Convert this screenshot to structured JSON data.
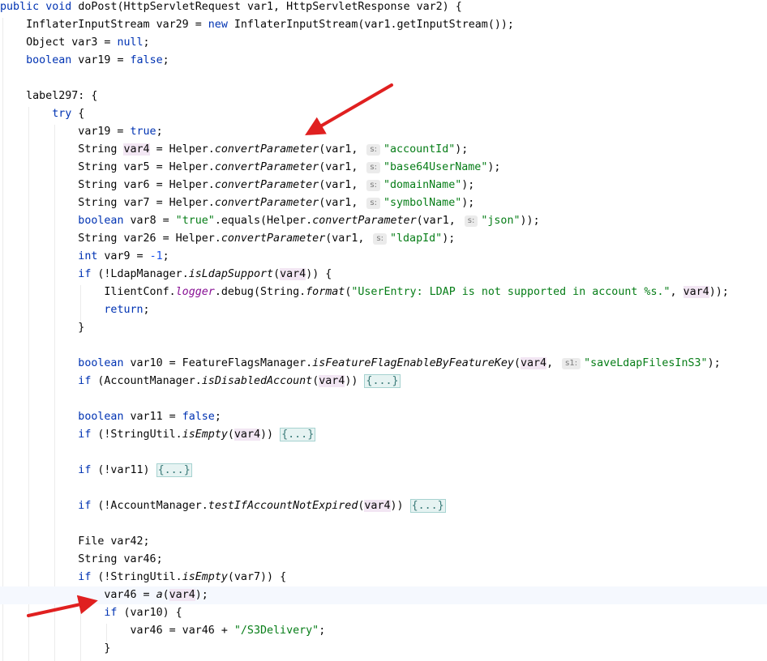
{
  "code": {
    "accent_keyword": "#0033b3",
    "accent_string": "#067d17",
    "lines": [
      {
        "id": "l1",
        "parts": [
          [
            "kw",
            "public"
          ],
          [
            "",
            " "
          ],
          [
            "kw",
            "void"
          ],
          [
            "",
            " doPost(HttpServletRequest var1, HttpServletResponse var2) {"
          ]
        ]
      },
      {
        "id": "l2",
        "parts": [
          [
            "",
            "    InflaterInputStream var29 = "
          ],
          [
            "kw",
            "new"
          ],
          [
            "",
            ""
          ],
          [
            "",
            " InflaterInputStream(var1.getInputStream());"
          ]
        ]
      },
      {
        "id": "l3",
        "parts": [
          [
            "",
            "    Object var3 = "
          ],
          [
            "kw",
            "null"
          ],
          [
            "",
            ";"
          ]
        ]
      },
      {
        "id": "l4",
        "parts": [
          [
            "",
            "    "
          ],
          [
            "kw",
            "boolean"
          ],
          [
            "",
            " var19 = "
          ],
          [
            "kw",
            "false"
          ],
          [
            "",
            ";"
          ]
        ]
      },
      {
        "id": "l5",
        "parts": []
      },
      {
        "id": "l6",
        "parts": [
          [
            "",
            "    label297: {"
          ]
        ]
      },
      {
        "id": "l7",
        "parts": [
          [
            "",
            "        "
          ],
          [
            "kw",
            "try"
          ],
          [
            "",
            " {"
          ]
        ]
      },
      {
        "id": "l8",
        "parts": [
          [
            "",
            "            var19 = "
          ],
          [
            "kw",
            "true"
          ],
          [
            "",
            ";"
          ]
        ]
      },
      {
        "id": "l9",
        "parts": [
          [
            "",
            "            String "
          ],
          [
            "var4",
            "var4"
          ],
          [
            "",
            " = Helper."
          ],
          [
            "st",
            "convertParameter"
          ],
          [
            "",
            "(var1, "
          ],
          [
            "hint",
            "s:"
          ],
          [
            "str",
            "\"accountId\""
          ],
          [
            "",
            ");"
          ]
        ]
      },
      {
        "id": "l10",
        "parts": [
          [
            "",
            "            String var5 = Helper."
          ],
          [
            "st",
            "convertParameter"
          ],
          [
            "",
            "(var1, "
          ],
          [
            "hint",
            "s:"
          ],
          [
            "str",
            "\"base64UserName\""
          ],
          [
            "",
            ");"
          ]
        ]
      },
      {
        "id": "l11",
        "parts": [
          [
            "",
            "            String var6 = Helper."
          ],
          [
            "st",
            "convertParameter"
          ],
          [
            "",
            "(var1, "
          ],
          [
            "hint",
            "s:"
          ],
          [
            "str",
            "\"domainName\""
          ],
          [
            "",
            ");"
          ]
        ]
      },
      {
        "id": "l12",
        "parts": [
          [
            "",
            "            String var7 = Helper."
          ],
          [
            "st",
            "convertParameter"
          ],
          [
            "",
            "(var1, "
          ],
          [
            "hint",
            "s:"
          ],
          [
            "str",
            "\"symbolName\""
          ],
          [
            "",
            ");"
          ]
        ]
      },
      {
        "id": "l13",
        "parts": [
          [
            "",
            "            "
          ],
          [
            "kw",
            "boolean"
          ],
          [
            "",
            " var8 = "
          ],
          [
            "str",
            "\"true\""
          ],
          [
            "",
            ".equals(Helper."
          ],
          [
            "st",
            "convertParameter"
          ],
          [
            "",
            "(var1, "
          ],
          [
            "hint",
            "s:"
          ],
          [
            "str",
            "\"json\""
          ],
          [
            "",
            "));"
          ]
        ]
      },
      {
        "id": "l14",
        "parts": [
          [
            "",
            "            String var26 = Helper."
          ],
          [
            "st",
            "convertParameter"
          ],
          [
            "",
            "(var1, "
          ],
          [
            "hint",
            "s:"
          ],
          [
            "str",
            "\"ldapId\""
          ],
          [
            "",
            ");"
          ]
        ]
      },
      {
        "id": "l15",
        "parts": [
          [
            "",
            "            "
          ],
          [
            "kw",
            "int"
          ],
          [
            "",
            " var9 = "
          ],
          [
            "num",
            "-1"
          ],
          [
            "",
            ";"
          ]
        ]
      },
      {
        "id": "l16",
        "parts": [
          [
            "",
            "            "
          ],
          [
            "kw",
            "if"
          ],
          [
            "",
            " (!LdapManager."
          ],
          [
            "st",
            "isLdapSupport"
          ],
          [
            "",
            "("
          ],
          [
            "var4",
            "var4"
          ],
          [
            "",
            ")) {"
          ]
        ]
      },
      {
        "id": "l17",
        "parts": [
          [
            "",
            "                IlientConf."
          ],
          [
            "fld",
            "logger"
          ],
          [
            "",
            ".debug(String."
          ],
          [
            "st",
            "format"
          ],
          [
            "",
            "("
          ],
          [
            "str",
            "\"UserEntry: LDAP is not supported in account %s.\""
          ],
          [
            "",
            ", "
          ],
          [
            "var4",
            "var4"
          ],
          [
            "",
            "));"
          ]
        ]
      },
      {
        "id": "l18",
        "parts": [
          [
            "",
            "                "
          ],
          [
            "kw",
            "return"
          ],
          [
            "",
            ";"
          ]
        ]
      },
      {
        "id": "l19",
        "parts": [
          [
            "",
            "            }"
          ]
        ]
      },
      {
        "id": "l20",
        "parts": []
      },
      {
        "id": "l21",
        "parts": [
          [
            "",
            "            "
          ],
          [
            "kw",
            "boolean"
          ],
          [
            "",
            " var10 = FeatureFlagsManager."
          ],
          [
            "st",
            "isFeatureFlagEnableByFeatureKey"
          ],
          [
            "",
            "("
          ],
          [
            "var4",
            "var4"
          ],
          [
            "",
            ", "
          ],
          [
            "hint",
            "s1:"
          ],
          [
            "str",
            "\"saveLdapFilesInS3\""
          ],
          [
            "",
            ");"
          ]
        ]
      },
      {
        "id": "l22",
        "parts": [
          [
            "",
            "            "
          ],
          [
            "kw",
            "if"
          ],
          [
            "",
            " (AccountManager."
          ],
          [
            "st",
            "isDisabledAccount"
          ],
          [
            "",
            "("
          ],
          [
            "var4",
            "var4"
          ],
          [
            "",
            ")) "
          ],
          [
            "fold",
            "{...}"
          ]
        ]
      },
      {
        "id": "l23",
        "parts": []
      },
      {
        "id": "l24",
        "parts": [
          [
            "",
            "            "
          ],
          [
            "kw",
            "boolean"
          ],
          [
            "",
            " var11 = "
          ],
          [
            "kw",
            "false"
          ],
          [
            "",
            ";"
          ]
        ]
      },
      {
        "id": "l25",
        "parts": [
          [
            "",
            "            "
          ],
          [
            "kw",
            "if"
          ],
          [
            "",
            " (!StringUtil."
          ],
          [
            "st",
            "isEmpty"
          ],
          [
            "",
            "("
          ],
          [
            "var4",
            "var4"
          ],
          [
            "",
            ")) "
          ],
          [
            "fold",
            "{...}"
          ]
        ]
      },
      {
        "id": "l26",
        "parts": []
      },
      {
        "id": "l27",
        "parts": [
          [
            "",
            "            "
          ],
          [
            "kw",
            "if"
          ],
          [
            "",
            " (!var11) "
          ],
          [
            "fold",
            "{...}"
          ]
        ]
      },
      {
        "id": "l28",
        "parts": []
      },
      {
        "id": "l29",
        "parts": [
          [
            "",
            "            "
          ],
          [
            "kw",
            "if"
          ],
          [
            "",
            " (!AccountManager."
          ],
          [
            "st",
            "testIfAccountNotExpired"
          ],
          [
            "",
            "("
          ],
          [
            "var4",
            "var4"
          ],
          [
            "",
            ")) "
          ],
          [
            "fold",
            "{...}"
          ]
        ]
      },
      {
        "id": "l30",
        "parts": []
      },
      {
        "id": "l31",
        "parts": [
          [
            "",
            "            File var42;"
          ]
        ]
      },
      {
        "id": "l32",
        "parts": [
          [
            "",
            "            String var46;"
          ]
        ]
      },
      {
        "id": "l33",
        "parts": [
          [
            "",
            "            "
          ],
          [
            "kw",
            "if"
          ],
          [
            "",
            " (!StringUtil."
          ],
          [
            "st",
            "isEmpty"
          ],
          [
            "",
            "(var7)) {"
          ]
        ]
      },
      {
        "id": "l34",
        "parts": [
          [
            "",
            "                var46 = "
          ],
          [
            "st",
            "a"
          ],
          [
            "",
            "("
          ],
          [
            "var4",
            "var4"
          ],
          [
            "",
            ");"
          ]
        ]
      },
      {
        "id": "l35",
        "parts": [
          [
            "",
            "                "
          ],
          [
            "kw",
            "if"
          ],
          [
            "",
            " (var10) {"
          ]
        ]
      },
      {
        "id": "l36",
        "parts": [
          [
            "",
            "                    var46 = var46 + "
          ],
          [
            "str",
            "\"/S3Delivery\""
          ],
          [
            "",
            ";"
          ]
        ]
      },
      {
        "id": "l37",
        "parts": [
          [
            "",
            "                }"
          ]
        ]
      }
    ]
  }
}
